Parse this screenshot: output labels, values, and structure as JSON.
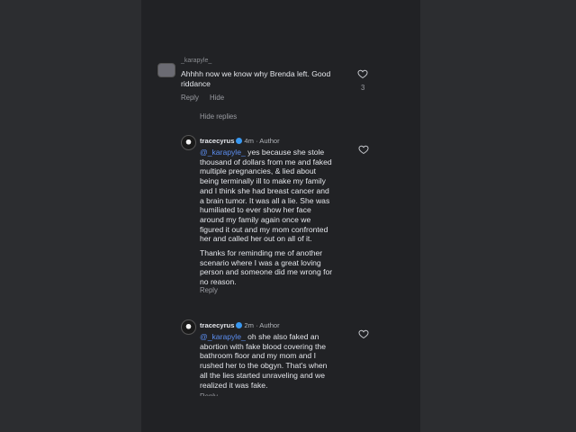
{
  "comment1": {
    "username": "_karapyle_",
    "text_line1": "Ahhhh now we know why Brenda left. Good",
    "text_line2": "riddance",
    "reply_label": "Reply",
    "hide_label": "Hide",
    "like_count": "3"
  },
  "hide_replies_label": "Hide replies",
  "reply1": {
    "username": "tracecyrus",
    "meta": "4m · Author",
    "mention": "@_karapyle_",
    "lines_p1": [
      " yes because she stole",
      "thousand of dollars from me and faked",
      "multiple pregnancies, & lied about",
      "being terminally ill  to make my family",
      "and I think she had breast cancer and",
      "a brain tumor. It was all a lie. She was",
      "humiliated to ever show her face",
      "around my family again once we",
      "figured it out and my mom confronted",
      "her and called her out on all of it."
    ],
    "lines_p2": [
      "Thanks for reminding me of another",
      "scenario where I was a great loving",
      "person and someone did me wrong for",
      "no reason."
    ],
    "reply_label": "Reply"
  },
  "reply2": {
    "username": "tracecyrus",
    "meta": "2m · Author",
    "mention": "@_karapyle_",
    "lines": [
      " oh she also faked an",
      "abortion with fake blood covering the",
      "bathroom floor and my mom and I",
      "rushed her to the obgyn. That's when",
      "all the lies started unraveling and we",
      "realized it was fake."
    ],
    "reply_label": "Reply"
  },
  "icons": {
    "like": "heart-outline-icon",
    "verified": "verified-badge-icon"
  },
  "colors": {
    "panel_bg": "#212225",
    "page_bg": "#2c2d30",
    "mention": "#5b8def",
    "verified": "#3897f0"
  }
}
